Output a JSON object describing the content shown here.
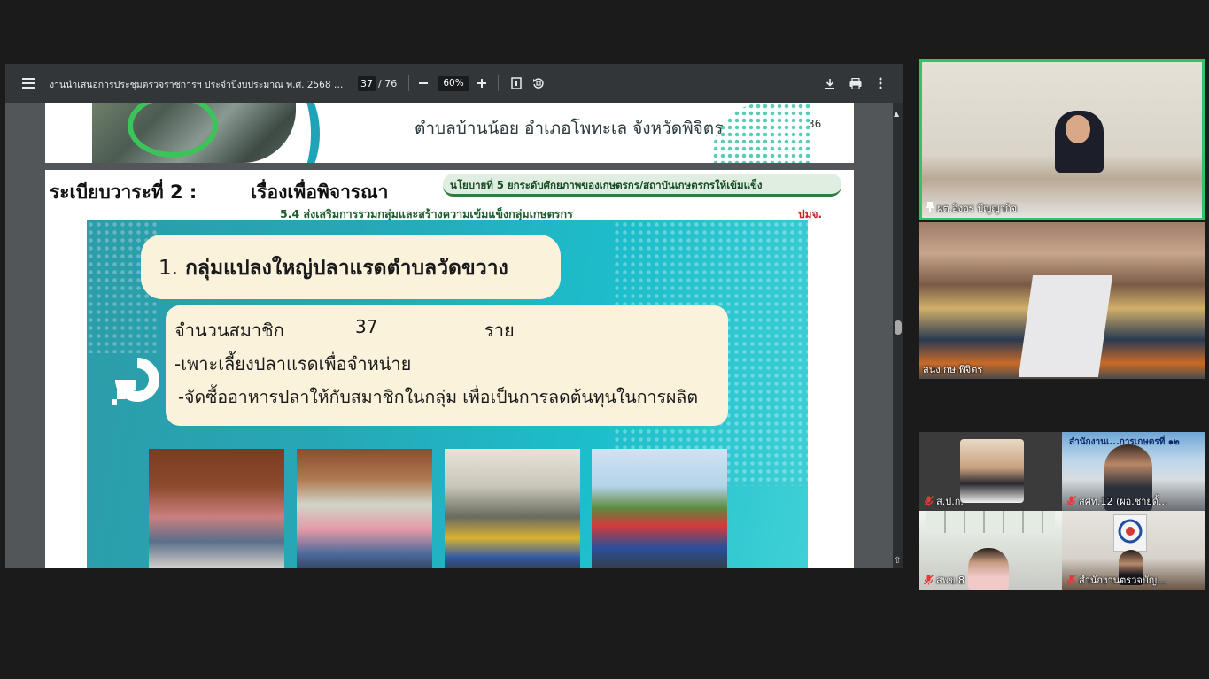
{
  "pdf_viewer": {
    "doc_title": "งานนำเสนอการประชุมตรวจราชการฯ ประจำปีงบประมาณ พ.ศ. 2568 รอ...",
    "page_current": "37",
    "page_total": "/ 76",
    "zoom": "60%"
  },
  "slide36": {
    "subtitle": "ตำบลบ้านน้อย อำเภอโพทะเล จังหวัดพิจิตร",
    "page_number": "36"
  },
  "slide37": {
    "agenda": "ระเบียบวาระที่ 2 :",
    "agenda_topic": "เรื่องเพื่อพิจารณา",
    "policy": "นโยบายที่ 5   ยกระดับศักยภาพของเกษตรกร/สถาบันเกษตรกรให้เข้มแข็ง",
    "policy_sub": "5.4 ส่งเสริมการรวมกลุ่มและสร้างความเข้มแข็งกลุ่มเกษตรกร",
    "dept": "ปมจ.",
    "group_number": "1.",
    "group_title": "กลุ่มแปลงใหญ่ปลาแรดตำบลวัดขวาง",
    "member_label": "จำนวนสมาชิก",
    "member_count": "37",
    "member_unit": "ราย",
    "activity1": "-เพาะเลี้ยงปลาแรดเพื่อจำหน่าย",
    "activity2": "-จัดซื้ออาหารปลาให้กับสมาชิกในกลุ่ม เพื่อเป็นการลดต้นทุนในการผลิต"
  },
  "participants": [
    {
      "name": "ผต.อิงอร  ปัญญากิจ",
      "pinned": true
    },
    {
      "name": "สนง.กษ.พิจิตร"
    },
    {
      "name": "ส.ป.ก.",
      "muted": true
    },
    {
      "name": "สศท.12 (ผอ.ชายดั้...",
      "muted": true,
      "banner": "สำนักงานเ...การเกษตรที่ ๑๒"
    },
    {
      "name": "สพข.8",
      "muted": true
    },
    {
      "name": "สำนักงานตรวจบัญ...",
      "muted": true
    }
  ],
  "colors": {
    "toolbar": "#323639",
    "viewer_bg": "#525659",
    "active_speaker_border": "#33c26a",
    "panel_teal": "#27a7b6",
    "cream_box": "#fbf2dc"
  }
}
